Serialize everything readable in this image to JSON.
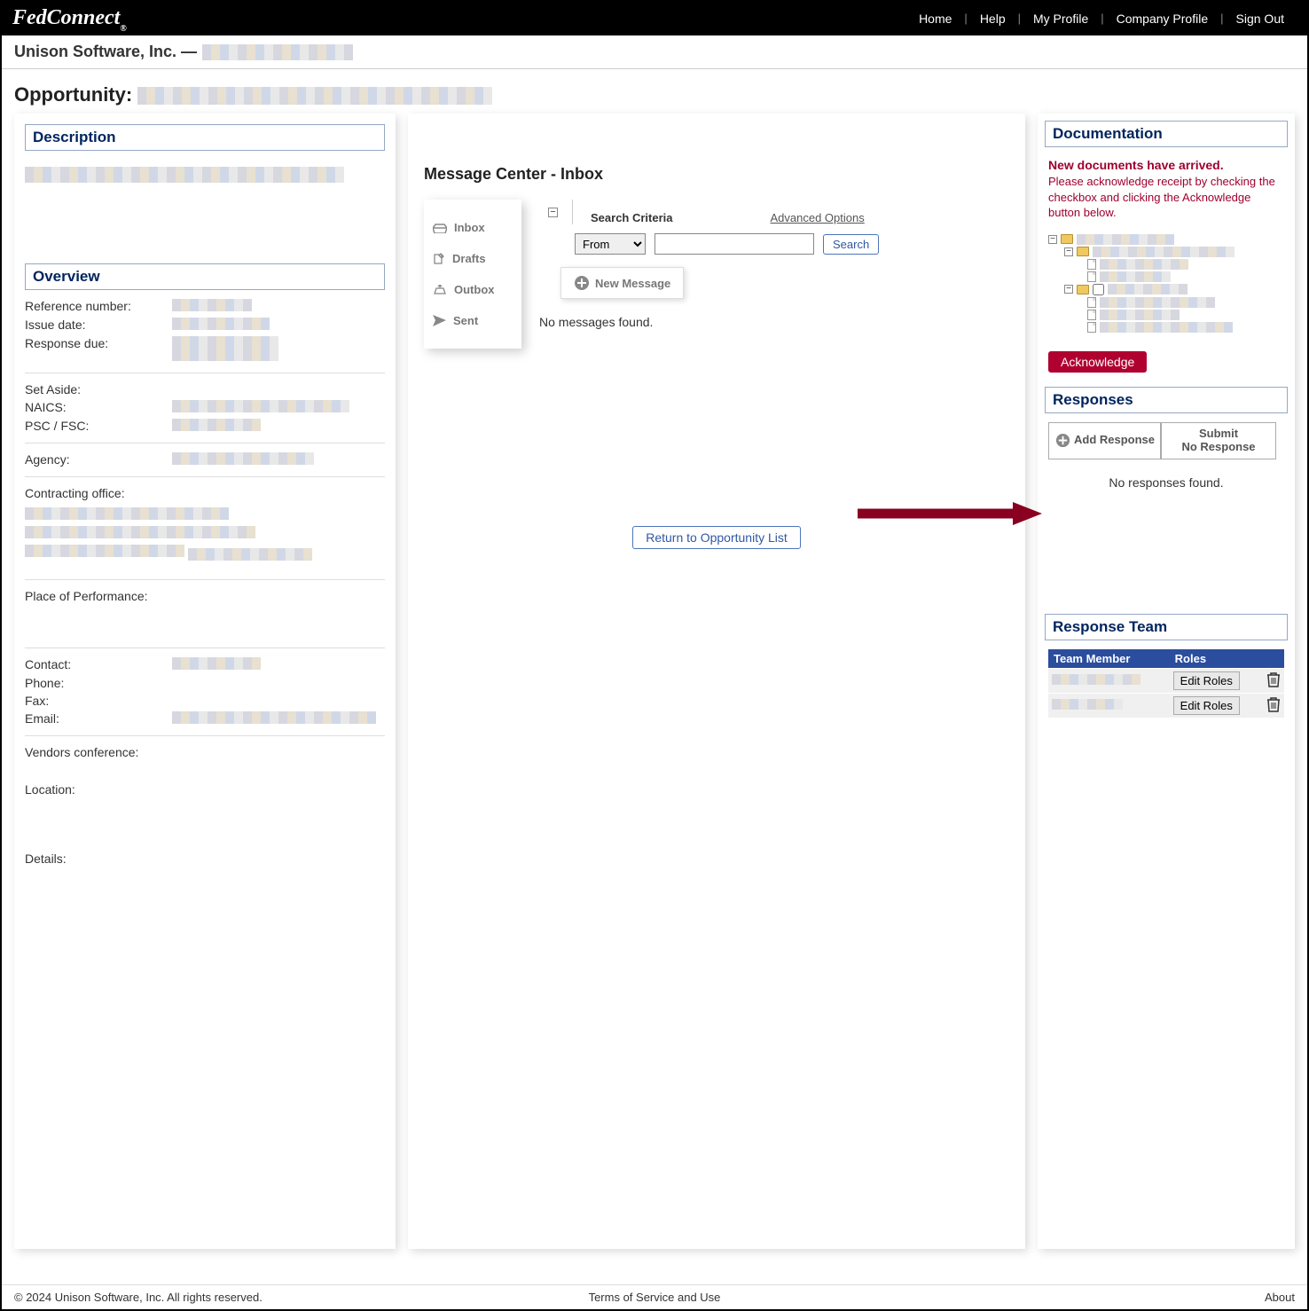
{
  "brand": "FedConnect",
  "brand_suffix": "®",
  "topnav": {
    "home": "Home",
    "help": "Help",
    "myprofile": "My Profile",
    "company": "Company Profile",
    "signout": "Sign Out"
  },
  "subhead_company": "Unison Software, Inc. —",
  "pagetitle_label": "Opportunity:",
  "left": {
    "description_title": "Description",
    "overview_title": "Overview",
    "fields": {
      "refnum": "Reference number:",
      "issuedate": "Issue date:",
      "responsedue": "Response due:",
      "setaside": "Set Aside:",
      "naics": "NAICS:",
      "pscfsc": "PSC / FSC:",
      "agency": "Agency:",
      "contracting": "Contracting office:",
      "place": "Place of Performance:",
      "contact": "Contact:",
      "phone": "Phone:",
      "fax": "Fax:",
      "email": "Email:",
      "vendors": "Vendors conference:",
      "location": "Location:",
      "details": "Details:"
    }
  },
  "mid": {
    "title": "Message Center - Inbox",
    "side": {
      "inbox": "Inbox",
      "drafts": "Drafts",
      "outbox": "Outbox",
      "sent": "Sent"
    },
    "search_label": "Search Criteria",
    "advanced": "Advanced Options",
    "from_option": "From",
    "search_btn": "Search",
    "new_msg": "New Message",
    "no_msg": "No messages found.",
    "return": "Return to Opportunity List"
  },
  "right": {
    "doc_title": "Documentation",
    "doc_alert": "New documents have arrived.",
    "doc_msg": "Please acknowledge receipt by checking the checkbox and clicking the Acknowledge button below.",
    "ack": "Acknowledge",
    "resp_title": "Responses",
    "add_response": "Add Response",
    "submit_line1": "Submit",
    "submit_line2": "No Response",
    "no_resp": "No responses found.",
    "team_title": "Response Team",
    "team_header_member": "Team Member",
    "team_header_roles": "Roles",
    "edit_roles": "Edit Roles"
  },
  "footer": {
    "copy": "© 2024 Unison Software, Inc. All rights reserved.",
    "terms": "Terms of Service and Use",
    "about": "About"
  }
}
